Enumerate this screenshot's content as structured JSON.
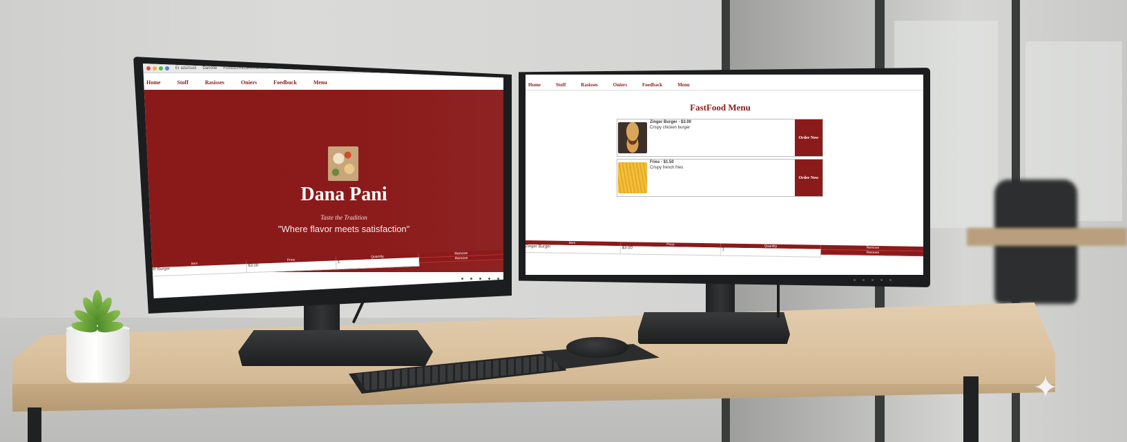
{
  "left_screen": {
    "browser": {
      "tabs": [
        "Er azurcust",
        "Danone",
        "Fcosoct.mtconcreement"
      ],
      "new_tab": "+"
    },
    "nav": [
      "Home",
      "Stoff",
      "Rasisses",
      "Oniers",
      "Foedbuck",
      "Menu"
    ],
    "hero": {
      "title": "Dana Pani",
      "subtitle": "Taste the Tradition",
      "quote": "\"Where flavor meets satisfaction\""
    },
    "table": {
      "headers": [
        "Item",
        "Price",
        "Quantity"
      ],
      "row": [
        "Zinger Burger",
        "$3.00",
        "1"
      ],
      "actions": [
        "Remove",
        "Remove"
      ]
    }
  },
  "right_screen": {
    "nav": [
      "Home",
      "Stoff",
      "Rasisses",
      "Oniers",
      "Foedback",
      "Menu"
    ],
    "menu_title": "FastFood Menu",
    "items": [
      {
        "title": "Zinger Burger - $3.00",
        "desc": "Crispy chicken burger",
        "image": "burger-photo",
        "button": "Order Now"
      },
      {
        "title": "Fries - $1.50",
        "desc": "Crispy french fries",
        "image": "fries-photo",
        "button": "Order Now"
      }
    ],
    "table": {
      "headers": [
        "Item",
        "Price",
        "Quantity"
      ],
      "row": [
        "Zinger Burger",
        "$3.00",
        "1"
      ],
      "actions": [
        "Remove",
        "Remove"
      ]
    }
  },
  "colors": {
    "brand": "#8b1a1a",
    "hero_bg": "#8a1a1a",
    "page_bg": "#ffffff"
  },
  "icons": [
    "window-close-dot",
    "window-minimize-dot",
    "window-maximize-dot",
    "sparkle-icon"
  ]
}
